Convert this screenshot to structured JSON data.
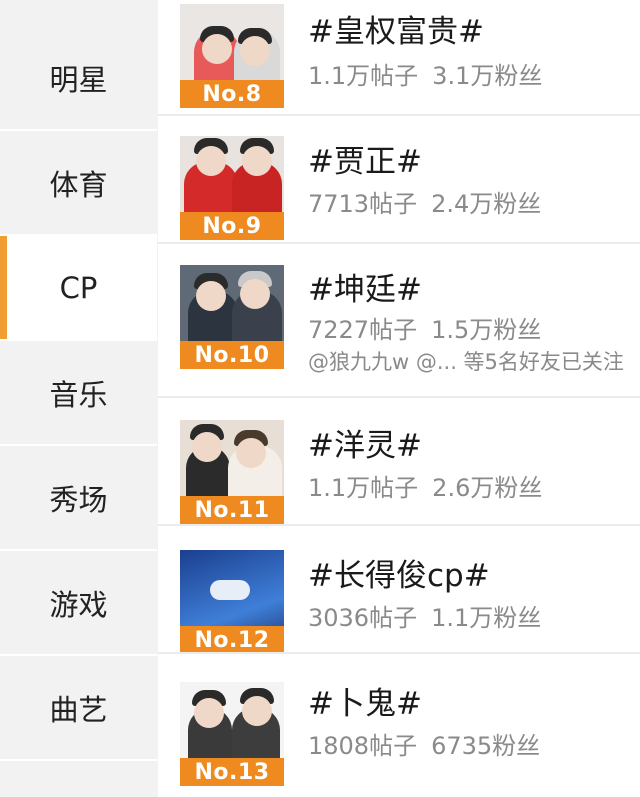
{
  "sidebar": {
    "items": [
      {
        "label": "明星"
      },
      {
        "label": "体育"
      },
      {
        "label": "CP"
      },
      {
        "label": "音乐"
      },
      {
        "label": "秀场"
      },
      {
        "label": "游戏"
      },
      {
        "label": "曲艺"
      }
    ],
    "active_index": 2,
    "active_color": "#f09e33"
  },
  "topics": [
    {
      "title": "#皇权富贵#",
      "posts": "1.1万帖子",
      "fans": "3.1万粉丝",
      "rank": "No.8"
    },
    {
      "title": "#贾正#",
      "posts": "7713帖子",
      "fans": "2.4万粉丝",
      "rank": "No.9"
    },
    {
      "title": "#坤廷#",
      "posts": "7227帖子",
      "fans": "1.5万粉丝",
      "rank": "No.10",
      "friends": "@狼九九w @... 等5名好友已关注"
    },
    {
      "title": "#洋灵#",
      "posts": "1.1万帖子",
      "fans": "2.6万粉丝",
      "rank": "No.11"
    },
    {
      "title": "#长得俊cp#",
      "posts": "3036帖子",
      "fans": "1.1万粉丝",
      "rank": "No.12"
    },
    {
      "title": "#卜鬼#",
      "posts": "1808帖子",
      "fans": "6735粉丝",
      "rank": "No.13"
    }
  ],
  "colors": {
    "rank_badge": "#ee8a1f",
    "meta_text": "#8a8a8a"
  }
}
